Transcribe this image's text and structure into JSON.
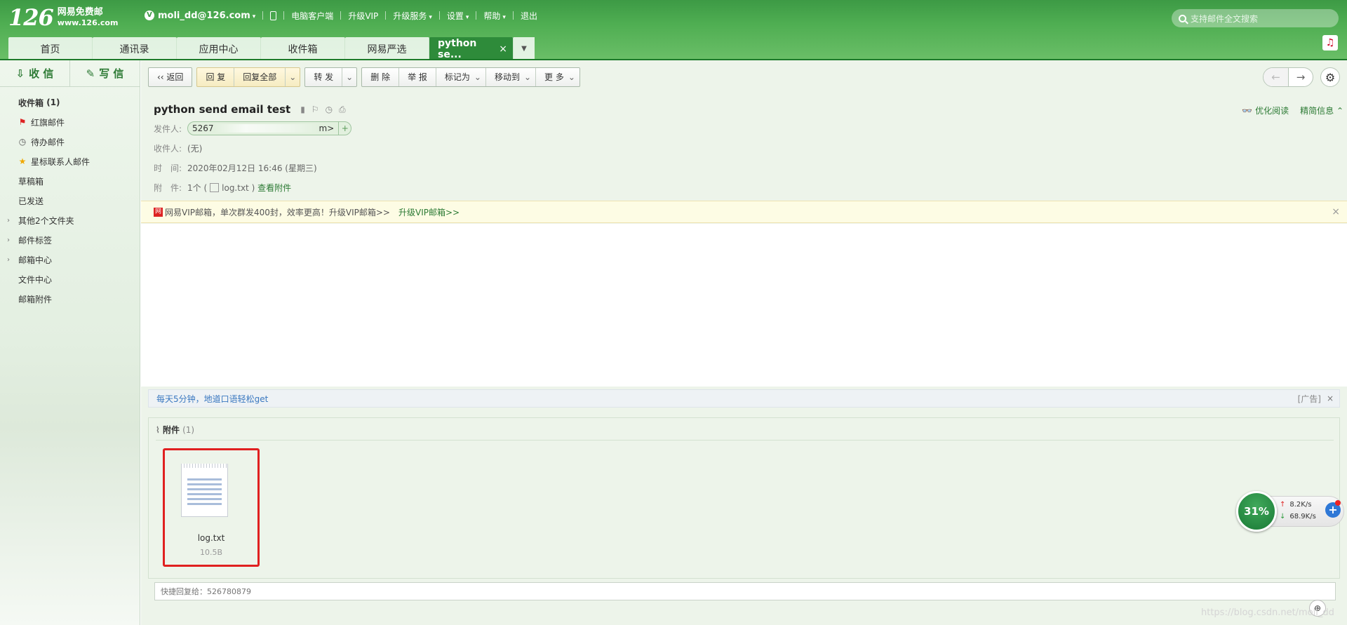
{
  "brand": {
    "number": "126",
    "name": "网易免费邮",
    "domain": "www.126.com"
  },
  "topnav": {
    "v_badge": "V",
    "account": "moli_dd@126.com",
    "links": [
      "电脑客户端",
      "升级VIP",
      "升级服务",
      "设置",
      "帮助",
      "退出"
    ]
  },
  "search": {
    "placeholder": "支持邮件全文搜索"
  },
  "tabs": [
    {
      "label": "首页"
    },
    {
      "label": "通讯录"
    },
    {
      "label": "应用中心"
    },
    {
      "label": "收件箱"
    },
    {
      "label": "网易严选"
    },
    {
      "label": "python se..."
    }
  ],
  "tab_close": "×",
  "sidebar": {
    "receive": "收 信",
    "compose": "写 信",
    "folders": [
      {
        "label": "收件箱",
        "count": "(1)"
      },
      {
        "label": "红旗邮件"
      },
      {
        "label": "待办邮件"
      },
      {
        "label": "星标联系人邮件"
      },
      {
        "label": "草稿箱"
      },
      {
        "label": "已发送"
      },
      {
        "label": "其他2个文件夹"
      },
      {
        "label": "邮件标签"
      },
      {
        "label": "邮箱中心"
      },
      {
        "label": "文件中心"
      },
      {
        "label": "邮箱附件"
      }
    ]
  },
  "toolbar": {
    "back": "返回",
    "reply": "回 复",
    "reply_all": "回复全部",
    "forward": "转 发",
    "delete": "删 除",
    "report": "举 报",
    "mark_as": "标记为",
    "move_to": "移动到",
    "more": "更 多"
  },
  "mail": {
    "subject": "python send email test",
    "optimize_read": "优化阅读",
    "brief_info": "精简信息",
    "from_label": "发件人:",
    "from_prefix": "5267",
    "from_suffix": "m>",
    "to_label": "收件人:",
    "to_value": "(无)",
    "time_label": "时　间:",
    "time_value": "2020年02月12日 16:46 (星期三)",
    "attach_label": "附　件:",
    "attach_summary_pre": "1个 (",
    "attach_summary_file": "log.txt",
    "attach_summary_post": ")",
    "view_attachments": "查看附件"
  },
  "vip_bar": {
    "icon_text": "网",
    "text": "网易VIP邮箱，单次群发400封，效率更高！升级VIP邮箱>>",
    "upgrade": "升级VIP邮箱>>",
    "close": "×"
  },
  "ad": {
    "text": "每天5分钟，地道口语轻松get",
    "tag": "[广告]",
    "close": "×"
  },
  "attachments": {
    "title": "附件",
    "count": "(1)",
    "files": [
      {
        "name": "log.txt",
        "size": "10.5B"
      }
    ]
  },
  "quick_reply": {
    "placeholder": "快捷回复给：526780879"
  },
  "speed_widget": {
    "percent": "31%",
    "up": "8.2K/s",
    "down": "68.9K/s"
  },
  "watermark": "https://blog.csdn.net/moli_dd"
}
